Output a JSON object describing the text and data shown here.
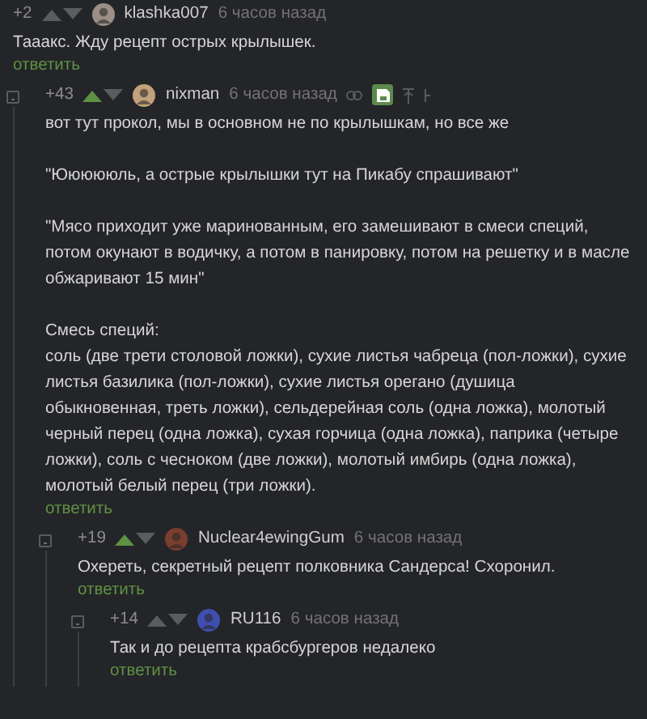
{
  "comments": [
    {
      "rating": "+2",
      "upvoted": false,
      "collapsible": false,
      "author": "klashka007",
      "time": "6 часов назад",
      "tools": false,
      "paragraphs": [
        [
          "Тааакс. Жду рецепт острых крылышек."
        ]
      ],
      "reply": "ответить",
      "children": [
        {
          "rating": "+43",
          "upvoted": true,
          "collapsible": true,
          "author": "nixman",
          "time": "6 часов назад",
          "tools": true,
          "paragraphs": [
            [
              "вот тут прокол, мы в основном не по крылышкам, но все же"
            ],
            [
              "\"Юююююль, а острые крылышки тут на Пикабу спрашивают\""
            ],
            [
              "\"Мясо приходит уже маринованным, его замешивают в смеси специй, потом окунают в водичку, а потом в панировку, потом на решетку и в масле обжаривают 15 мин\""
            ],
            [
              "Смесь специй:",
              "соль (две трети столовой ложки), сухие листья чабреца (пол-ложки), сухие листья базилика (пол-ложки), сухие листья орегано (душица обыкновенная, треть ложки), сельдерейная соль (одна ложка), молотый черный перец (одна ложка), сухая горчица (одна ложка), паприка (четыре ложки), соль с чесноком (две ложки), молотый имбирь (одна ложка), молотый белый перец (три ложки)."
            ]
          ],
          "reply": "ответить",
          "children": [
            {
              "rating": "+19",
              "upvoted": true,
              "collapsible": true,
              "author": "Nuclear4ewingGum",
              "time": "6 часов назад",
              "tools": false,
              "paragraphs": [
                [
                  "Охереть, секретный рецепт полковника Сандерса! Схоронил."
                ]
              ],
              "reply": "ответить",
              "children": [
                {
                  "rating": "+14",
                  "upvoted": false,
                  "collapsible": true,
                  "author": "RU116",
                  "time": "6 часов назад",
                  "tools": false,
                  "paragraphs": [
                    [
                      "Так и до рецепта крабсбургеров недалеко"
                    ]
                  ],
                  "reply": "ответить"
                }
              ]
            }
          ]
        }
      ]
    }
  ]
}
